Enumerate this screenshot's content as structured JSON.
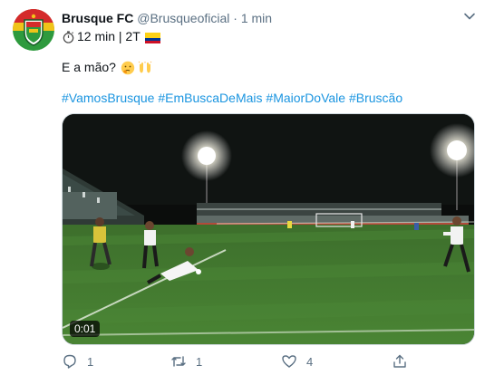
{
  "tweet": {
    "display_name": "Brusque FC",
    "handle": "@Brusqueoficial",
    "separator": "·",
    "timestamp": "1 min",
    "status_line": "12 min | 2T",
    "text": "E a mão?",
    "emojis": [
      "thinking-face-emoji",
      "raising-hands-emoji"
    ],
    "hashtags": [
      "#VamosBrusque",
      "#EmBuscaDeMais",
      "#MaiorDoVale",
      "#Bruscão"
    ],
    "video": {
      "duration": "0:01"
    },
    "actions": {
      "reply_count": "1",
      "retweet_count": "1",
      "like_count": "4",
      "share_count": ""
    }
  },
  "icons": [
    "stopwatch-icon",
    "colombia-flag-icon",
    "chevron-down-icon",
    "reply-icon",
    "retweet-icon",
    "like-icon",
    "share-icon"
  ],
  "colors": {
    "link": "#1b95e0",
    "secondary_text": "#5b7083",
    "primary_text": "#0f1419",
    "pitch": "#3f7a2c"
  }
}
